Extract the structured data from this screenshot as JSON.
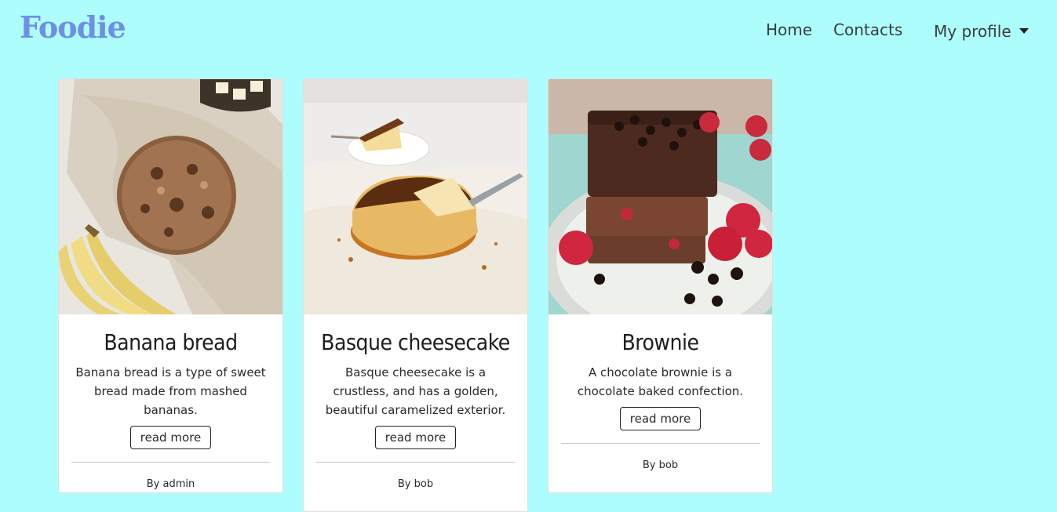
{
  "navbar": {
    "brand": "Foodie",
    "links": {
      "home": "Home",
      "contacts": "Contacts",
      "profile": "My profile"
    }
  },
  "colors": {
    "background": "#aefdfd",
    "brand": "#6f8fe6",
    "card": "#ffffff"
  },
  "cards": [
    {
      "title": "Banana bread",
      "text": "Banana bread is a type of sweet bread made from mashed bananas.",
      "button": "read more",
      "author": "By admin",
      "image": "banana-bread-photo"
    },
    {
      "title": "Basque cheesecake",
      "text": "Basque cheesecake is a crustless, and has a golden, beautiful caramelized exterior.",
      "button": "read more",
      "author": "By bob",
      "image": "basque-cheesecake-photo"
    },
    {
      "title": "Brownie",
      "text": "A chocolate brownie is a chocolate baked confection.",
      "button": "read more",
      "author": "By bob",
      "image": "brownie-photo"
    }
  ]
}
